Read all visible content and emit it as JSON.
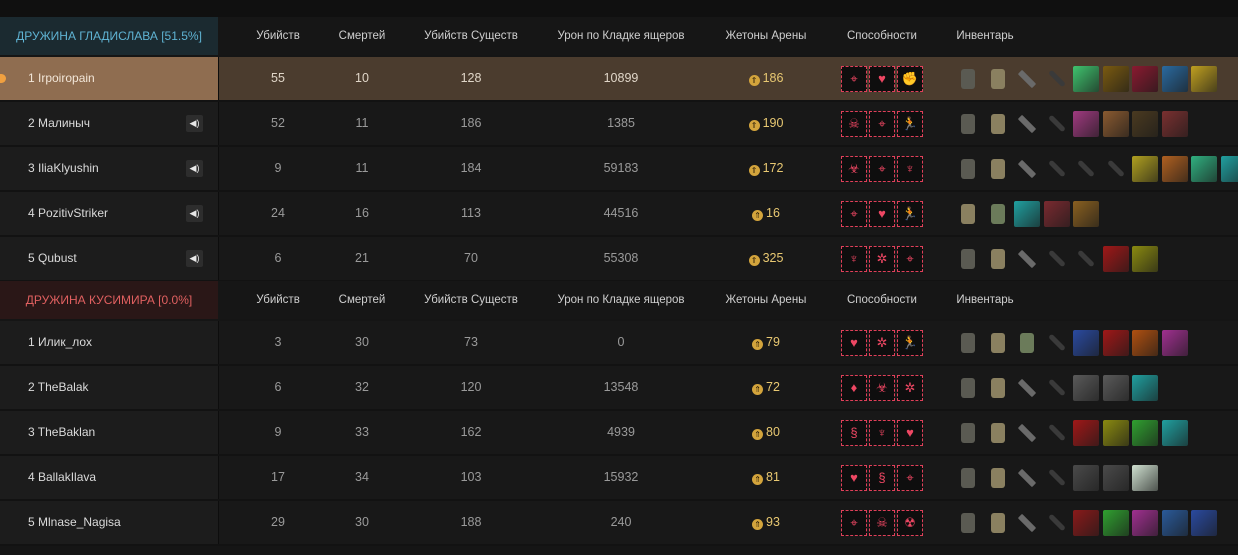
{
  "columns": {
    "kills": "Убийств",
    "deaths": "Смертей",
    "creature_kills": "Убийств Существ",
    "lizard_damage": "Урон по Кладке ящеров",
    "arena_tokens": "Жетоны Арены",
    "abilities": "Способности",
    "inventory": "Инвентарь"
  },
  "teams": [
    {
      "name": "ДРУЖИНА ГЛАДИСЛАВА [51.5%]",
      "color": "#5fb3d3",
      "players": [
        {
          "name": "1 Irpoiropain",
          "kills": "55",
          "deaths": "10",
          "creature_kills": "128",
          "lizard_damage": "10899",
          "tokens": "186",
          "speaker": false,
          "highlighted": true,
          "abilities": [
            "target",
            "heart",
            "brawl"
          ],
          "inventory": [
            "armor",
            "grenade",
            "knife",
            "shotgun",
            "#3fc46e",
            "#7a5a10",
            "#8a1a30",
            "#2a6aa0",
            "#c0a020"
          ]
        },
        {
          "name": "2 Малиныч",
          "kills": "52",
          "deaths": "11",
          "creature_kills": "186",
          "lizard_damage": "1385",
          "tokens": "190",
          "speaker": true,
          "highlighted": false,
          "abilities": [
            "skull",
            "target",
            "runner"
          ],
          "inventory": [
            "armor",
            "grenade",
            "knife",
            "shotgun",
            "#a03a80",
            "#8a5a30",
            "#4a3a20",
            "#7a3030"
          ]
        },
        {
          "name": "3 IliaKlyushin",
          "kills": "9",
          "deaths": "11",
          "creature_kills": "184",
          "lizard_damage": "59183",
          "tokens": "172",
          "speaker": true,
          "highlighted": false,
          "abilities": [
            "demon",
            "target",
            "wings"
          ],
          "inventory": [
            "armor",
            "grenade",
            "knife",
            "shotgun",
            "rifle",
            "shotgun",
            "#b0a020",
            "#b06020",
            "#30b080",
            "#20a0a0"
          ]
        },
        {
          "name": "4 PozitivStriker",
          "kills": "24",
          "deaths": "16",
          "creature_kills": "113",
          "lizard_damage": "44516",
          "tokens": "16",
          "speaker": true,
          "highlighted": false,
          "abilities": [
            "target",
            "heart",
            "runner"
          ],
          "inventory": [
            "grenade",
            "toxin",
            "#20a0a0",
            "#7a2a30",
            "#8a6020"
          ]
        },
        {
          "name": "5 Qubust",
          "kills": "6",
          "deaths": "21",
          "creature_kills": "70",
          "lizard_damage": "55308",
          "tokens": "325",
          "speaker": true,
          "highlighted": false,
          "abilities": [
            "wings",
            "spider",
            "target"
          ],
          "inventory": [
            "armor",
            "grenade",
            "knife",
            "rifle",
            "pistol",
            "#a01818",
            "#8a8a10"
          ]
        }
      ]
    },
    {
      "name": "ДРУЖИНА КУСИМИРА [0.0%]",
      "color": "#e06060",
      "players": [
        {
          "name": "1 Илик_лох",
          "kills": "3",
          "deaths": "30",
          "creature_kills": "73",
          "lizard_damage": "0",
          "tokens": "79",
          "speaker": false,
          "highlighted": false,
          "abilities": [
            "heart",
            "spider",
            "runner"
          ],
          "inventory": [
            "armor",
            "grenade",
            "toxin",
            "shotgun",
            "#2a4aa0",
            "#a01818",
            "#b05010",
            "#a03090"
          ]
        },
        {
          "name": "2 TheBalak",
          "kills": "6",
          "deaths": "32",
          "creature_kills": "120",
          "lizard_damage": "13548",
          "tokens": "72",
          "speaker": false,
          "highlighted": false,
          "abilities": [
            "drop",
            "demon",
            "spider"
          ],
          "inventory": [
            "armor",
            "grenade",
            "knife",
            "rifle",
            "#5a5a5a",
            "#5a5a5a",
            "#20a0a0"
          ]
        },
        {
          "name": "3 TheBaklan",
          "kills": "9",
          "deaths": "33",
          "creature_kills": "162",
          "lizard_damage": "4939",
          "tokens": "80",
          "speaker": false,
          "highlighted": false,
          "abilities": [
            "swirl",
            "wings",
            "heart"
          ],
          "inventory": [
            "armor",
            "grenade",
            "knife",
            "shotgun",
            "#a01818",
            "#8a8a10",
            "#30a030",
            "#20a0a0"
          ]
        },
        {
          "name": "4 BallakIlava",
          "kills": "17",
          "deaths": "34",
          "creature_kills": "103",
          "lizard_damage": "15932",
          "tokens": "81",
          "speaker": false,
          "highlighted": false,
          "abilities": [
            "heart",
            "swirl",
            "target"
          ],
          "inventory": [
            "armor",
            "grenade",
            "knife",
            "shotgun",
            "#4a4a4a",
            "#4a4a4a",
            "#cfe0d0"
          ]
        },
        {
          "name": "5 Mlnase_Nagisa",
          "kills": "29",
          "deaths": "30",
          "creature_kills": "188",
          "lizard_damage": "240",
          "tokens": "93",
          "speaker": false,
          "highlighted": false,
          "abilities": [
            "target",
            "skull",
            "radiation"
          ],
          "inventory": [
            "armor",
            "grenade",
            "knife",
            "shotgun",
            "#8a1a1a",
            "#30a030",
            "#a03090",
            "#2a5a9a",
            "#2a4aa0"
          ]
        }
      ]
    }
  ],
  "icons": {
    "speaker": "speaker-icon",
    "token": "arena-token-icon"
  }
}
